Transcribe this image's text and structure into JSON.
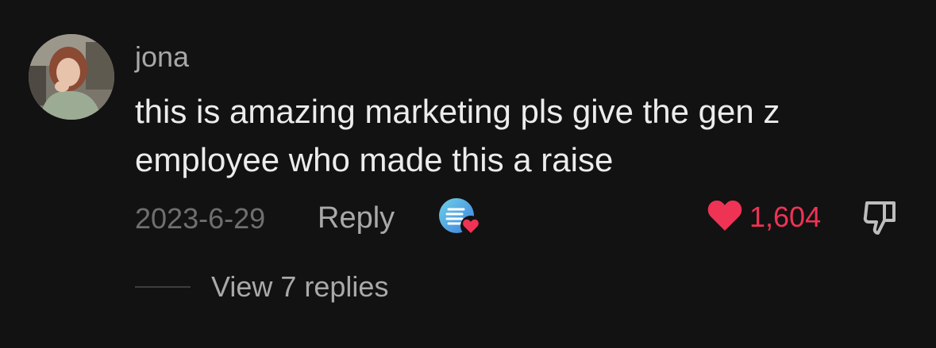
{
  "comment": {
    "username": "jona",
    "text": "this is amazing marketing pls give the gen z employee who made this a raise",
    "timestamp": "2023-6-29",
    "reply_label": "Reply",
    "like_count": "1,604",
    "liked": true,
    "liked_by_creator": true,
    "view_replies_label": "View 7 replies"
  },
  "colors": {
    "background": "#121212",
    "like_accent": "#ee3355",
    "primary_text": "#ececec",
    "secondary_text": "#a9a9a9"
  },
  "icons": {
    "avatar": "user-avatar",
    "creator_badge": "creator-avatar-icon",
    "like": "heart-icon",
    "dislike": "thumbs-down-icon"
  }
}
